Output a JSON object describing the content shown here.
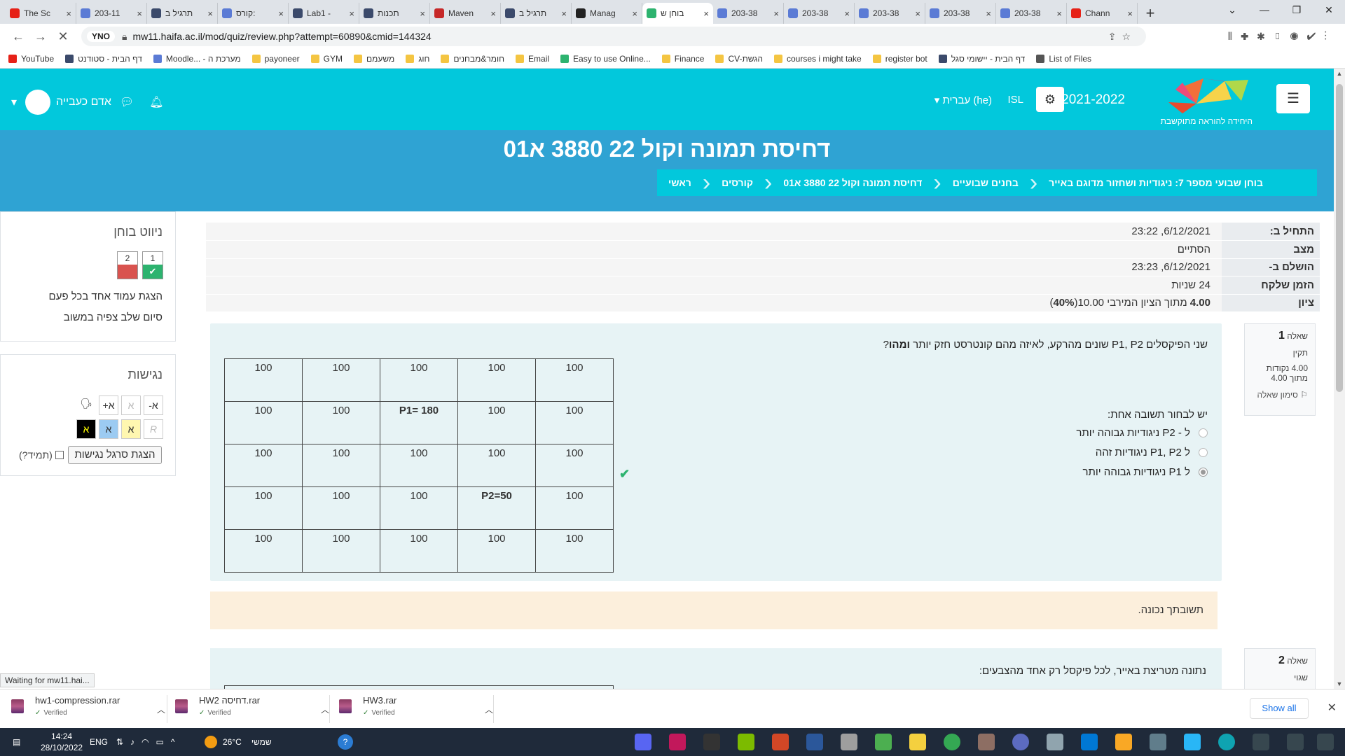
{
  "browser": {
    "tabs": [
      {
        "title": "The Sc",
        "color": "#e62117"
      },
      {
        "title": "203-11",
        "color": "#5b7bd5"
      },
      {
        "title": "תרגיל ב",
        "color": "#3b4a6b"
      },
      {
        "title": "קורס:",
        "color": "#5b7bd5"
      },
      {
        "title": "Lab1 -",
        "color": "#3b4a6b"
      },
      {
        "title": "תכנות",
        "color": "#3b4a6b"
      },
      {
        "title": "Maven",
        "color": "#c62828"
      },
      {
        "title": "תרגיל ב",
        "color": "#3b4a6b"
      },
      {
        "title": "Manag",
        "color": "#222222"
      },
      {
        "title": "בוחן ש",
        "color": "#2db36f",
        "active": true
      },
      {
        "title": "203-38",
        "color": "#5b7bd5"
      },
      {
        "title": "203-38",
        "color": "#5b7bd5"
      },
      {
        "title": "203-38",
        "color": "#5b7bd5"
      },
      {
        "title": "203-38",
        "color": "#5b7bd5"
      },
      {
        "title": "203-38",
        "color": "#5b7bd5"
      },
      {
        "title": "Chann",
        "color": "#e62117"
      }
    ],
    "tab_close": "×",
    "new_tab": "+",
    "win_controls": [
      "⌄",
      "—",
      "❐",
      "✕"
    ],
    "nav_back": "←",
    "nav_forward": "→",
    "reload": "✕",
    "site_badge": "YNO",
    "url": "mw11.haifa.ac.il/mod/quiz/review.php?attempt=60890&cmid=144324",
    "bookmarks": [
      {
        "label": "YouTube",
        "color": "#e62117"
      },
      {
        "label": "דף הבית - סטודנט",
        "color": "#3b4a6b"
      },
      {
        "label": "Moodle... - מערכת ה",
        "color": "#5b7bd5"
      },
      {
        "label": "payoneer",
        "color": "#f4c542"
      },
      {
        "label": "GYM",
        "color": "#f4c542"
      },
      {
        "label": "משעמם",
        "color": "#f4c542"
      },
      {
        "label": "חוג",
        "color": "#f4c542"
      },
      {
        "label": "חומר&מבחנים",
        "color": "#f4c542"
      },
      {
        "label": "Email",
        "color": "#f4c542"
      },
      {
        "label": "Easy to use Online...",
        "color": "#2db36f"
      },
      {
        "label": "Finance",
        "color": "#f4c542"
      },
      {
        "label": "CV-הגשת",
        "color": "#f4c542"
      },
      {
        "label": "courses i might take",
        "color": "#f4c542"
      },
      {
        "label": "register bot",
        "color": "#f4c542"
      },
      {
        "label": "דף הבית - יישומי סגל",
        "color": "#3b4a6b"
      },
      {
        "label": "List of Files",
        "color": "#555555"
      }
    ]
  },
  "moodle": {
    "user_name": "אדם כעבייה",
    "year": "2021-2022",
    "logo_caption": "היחידה להוראה מתוקשבת",
    "isl": "ISL",
    "language": "עברית (he)",
    "course_title": "דחיסת תמונה וקול 22 3880 א01",
    "breadcrumb": [
      "ראשי",
      "קורסים",
      "דחיסת תמונה וקול 22 3880 א01",
      "בחנים שבועיים",
      "בוחן שבועי מספר 7: ניגודיות ושחזור מדוגם באייר"
    ],
    "accent": "#02c8dc",
    "header_color": "#2fa3d3"
  },
  "summary": [
    {
      "label": "התחיל ב:",
      "value": "6/12/2021, 23:22"
    },
    {
      "label": "מצב",
      "value": "הסתיים"
    },
    {
      "label": "הושלם ב-",
      "value": "6/12/2021, 23:23"
    },
    {
      "label": "הזמן שלקח",
      "value": "24 שניות"
    },
    {
      "label": "ציון",
      "value_bold": "4.00",
      "value_rest": " מתוך הציון המירבי 10.00(",
      "value_pct": "40%",
      "value_end": ")"
    }
  ],
  "question1": {
    "label": "שאלה",
    "number": "1",
    "state": "תקין",
    "points": "4.00 נקודות",
    "max": "מתוך 4.00",
    "flag": "סימון שאלה",
    "text_pre": "שני הפיקסלים   P1, P2 שונים מהרקע, לאיזה מהם קונטרסט חזק יותר ",
    "text_bold": "ומהו",
    "text_end": "?",
    "grid": [
      [
        "100",
        "100",
        "100",
        "100",
        "100"
      ],
      [
        "100",
        "100",
        "P1= 180",
        "100",
        "100"
      ],
      [
        "100",
        "100",
        "100",
        "100",
        "100"
      ],
      [
        "100",
        "100",
        "100",
        "P2=50",
        "100"
      ],
      [
        "100",
        "100",
        "100",
        "100",
        "100"
      ]
    ],
    "prompt": "יש לבחור תשובה אחת:",
    "options": [
      "ל - P2 ניגודיות גבוהה יותר",
      "ל P1, P2 ניגודיות זהה",
      "ל  P1 ניגודיות גבוהה יותר"
    ],
    "selected_index": 2,
    "correct_mark": "✔",
    "feedback": "תשובתך נכונה."
  },
  "question2": {
    "label": "שאלה",
    "number": "2",
    "state": "שגוי",
    "text": "נתונה מטריצת באייר, לכל פיקסל רק אחד מהצבעים:"
  },
  "quiz_nav": {
    "title": "ניווט בוחן",
    "q1": "1",
    "q2": "2",
    "q1_color": "#2db36f",
    "q2_color": "#d9534f",
    "one_page": "הצגת עמוד אחד בכל פעם",
    "finish": "סיום שלב צפיה במשוב"
  },
  "accessibility": {
    "title": "נגישות",
    "font_dec": "א-",
    "font_reset": "א",
    "font_inc": "א+",
    "theme_reset": "R",
    "theme_yellow": "א",
    "theme_blue": "א",
    "theme_black": "א",
    "bar_button": "הצגת סרגל נגישות",
    "always": "(תמיד?)"
  },
  "status_text": "Waiting for mw11.hai...",
  "downloads": [
    {
      "name": "hw1-compression.rar",
      "verified": "Verified"
    },
    {
      "name": "HW2 דחיסה.rar",
      "verified": "Verified"
    },
    {
      "name": "HW3.rar",
      "verified": "Verified"
    }
  ],
  "show_all": "Show all",
  "taskbar": {
    "time": "14:24",
    "date": "28/10/2022",
    "lang": "ENG",
    "weather": "26°C",
    "weather_desc": "שמשי"
  }
}
